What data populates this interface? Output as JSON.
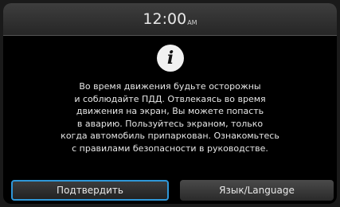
{
  "status_bar": {
    "time": "12:00",
    "ampm": "AM"
  },
  "dialog": {
    "icon": "info-icon",
    "icon_glyph": "i",
    "message_lines": [
      "Во время движения будьте осторожны",
      "и соблюдайте ПДД. Отвлекаясь во время",
      "движения на экран, Вы можете попасть",
      "в аварию. Пользуйтесь экраном, только",
      "когда автомобиль припаркован. Ознакомьтесь",
      "с правилами безопасности в руководстве."
    ]
  },
  "buttons": {
    "confirm": "Подтвердить",
    "language": "Язык/Language"
  },
  "colors": {
    "focus": "#2f97d8",
    "background": "#000000"
  }
}
